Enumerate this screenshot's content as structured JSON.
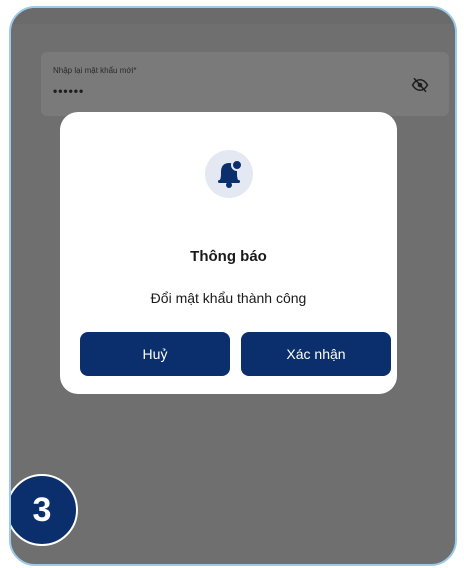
{
  "form": {
    "confirm_password_label": "Nhập lại mật khẩu mới*",
    "confirm_password_value": "••••••",
    "visibility_icon": "eye-off-icon"
  },
  "dialog": {
    "icon": "bell-icon",
    "title": "Thông báo",
    "message": "Đổi mật khẩu thành công",
    "cancel_label": "Huỷ",
    "confirm_label": "Xác nhận"
  },
  "step_badge": "3",
  "colors": {
    "primary": "#0b2f6c",
    "overlay": "#6f6f6f",
    "border": "#9ccbea",
    "icon_bg": "#e3e8f2"
  }
}
